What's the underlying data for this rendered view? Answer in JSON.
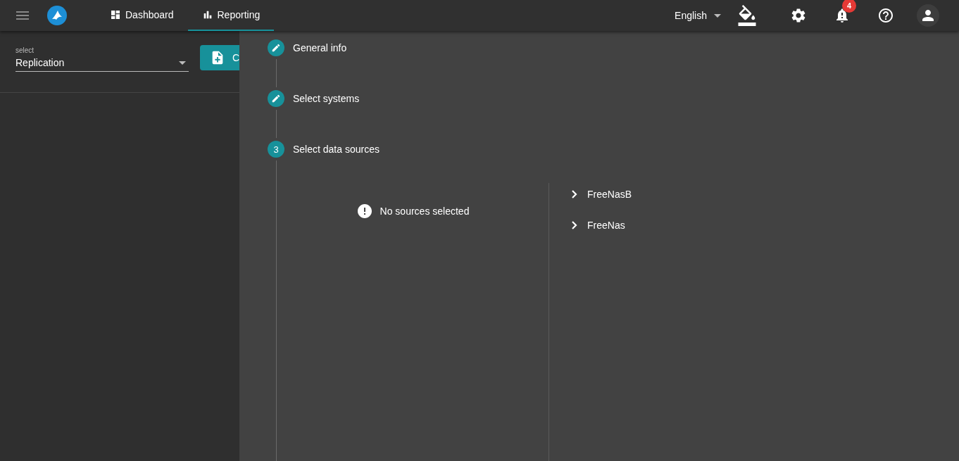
{
  "header": {
    "nav": [
      {
        "label": "Dashboard",
        "kind": "dashboard",
        "selected": false
      },
      {
        "label": "Reporting",
        "kind": "chart",
        "selected": true
      }
    ],
    "language": "English",
    "notifications": "4"
  },
  "sidebar": {
    "select": {
      "label": "select",
      "value": "Replication"
    },
    "button": "C"
  },
  "steps": [
    {
      "kind": "edit",
      "title": "General info"
    },
    {
      "kind": "edit",
      "title": "Select systems"
    },
    {
      "marker": "3",
      "title": "Select data sources",
      "kind": "number"
    }
  ],
  "sources": {
    "empty_message": "No sources selected",
    "systems": [
      {
        "label": "FreeNasB",
        "expanded": false
      },
      {
        "label": "FreeNas",
        "expanded": false
      }
    ]
  }
}
